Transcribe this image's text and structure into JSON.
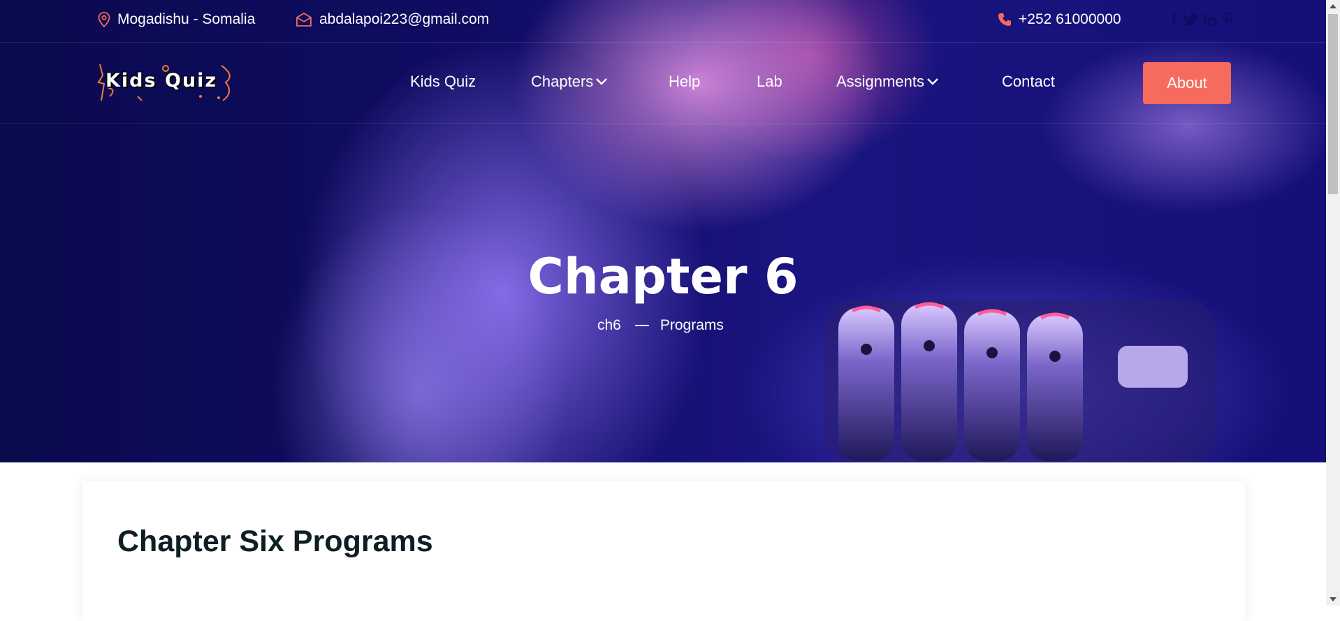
{
  "topbar": {
    "location": "Mogadishu - Somalia",
    "email": "abdalapoi223@gmail.com",
    "phone": "+252 61000000",
    "social_icons": [
      "facebook-icon",
      "twitter-icon",
      "linkedin-icon",
      "pinterest-icon"
    ]
  },
  "logo": {
    "text": "Kids Quiz"
  },
  "nav": {
    "items": [
      {
        "label": "Kids Quiz",
        "dropdown": false
      },
      {
        "label": "Chapters",
        "dropdown": true
      },
      {
        "label": "Help",
        "dropdown": false
      },
      {
        "label": "Lab",
        "dropdown": false
      },
      {
        "label": "Assignments",
        "dropdown": true
      },
      {
        "label": "Contact",
        "dropdown": false
      }
    ],
    "about_button": "About"
  },
  "hero": {
    "title": "Chapter 6",
    "breadcrumb": [
      "ch6",
      "Programs"
    ]
  },
  "content": {
    "title": "Chapter Six Programs"
  },
  "colors": {
    "accent": "#f76b5f",
    "navy": "#0f0c62",
    "heading": "#0e1f24"
  }
}
